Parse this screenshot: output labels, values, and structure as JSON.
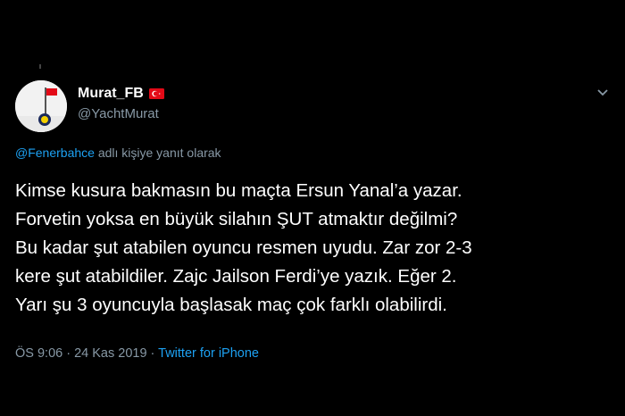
{
  "tweet": {
    "display_name": "Murat_FB",
    "handle": "@YachtMurat",
    "reply_mention": "@Fenerbahce",
    "reply_suffix": " adlı kişiye yanıt olarak",
    "text": "Kimse kusura bakmasın bu maçta Ersun Yanal’a yazar.\nForvetin yoksa en büyük silahın ŞUT atmaktır değilmi?\nBu kadar şut atabilen oyuncu resmen uyudu. Zar zor 2-3\nkere şut atabildiler. Zajc Jailson Ferdi’ye yazık. Eğer 2.\nYarı şu 3 oyuncuyla başlasak maç çok farklı olabilirdi.",
    "time": "ÖS 9:06",
    "separator1": " · ",
    "date": "24 Kas 2019",
    "separator2": " · ",
    "source": "Twitter for iPhone"
  },
  "icons": {
    "flag": "turkey-flag-icon",
    "menu": "chevron-down-icon"
  },
  "colors": {
    "background": "#000000",
    "text": "#ffffff",
    "secondary": "#8899a6",
    "link": "#1da1f2",
    "flag_red": "#e30a17"
  }
}
